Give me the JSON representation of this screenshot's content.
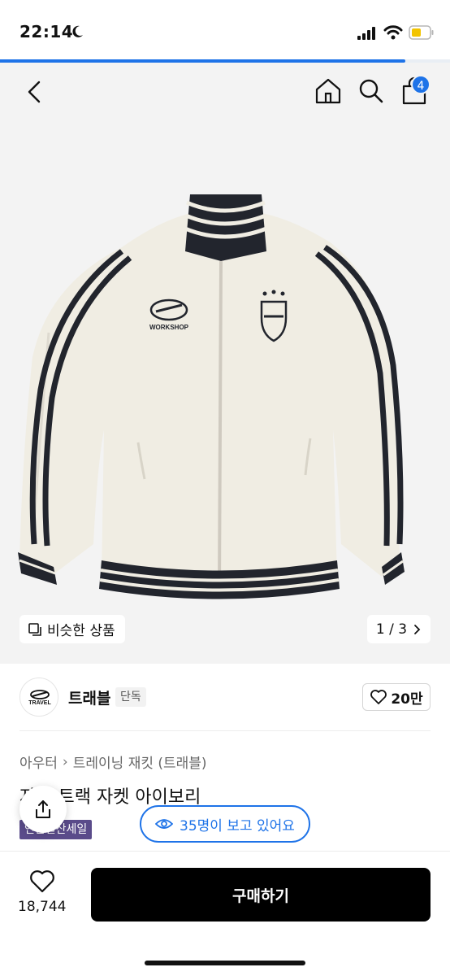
{
  "status_bar": {
    "time": "22:14"
  },
  "page_progress": 0.9,
  "header": {
    "cart_count": "4"
  },
  "product_image": {
    "similar_label": "비슷한 상품",
    "counter": "1 / 3",
    "jacket_print_text": "WORKSHOP"
  },
  "brand": {
    "name": "트래블",
    "tag": "단독",
    "logo_text": "TRAVEL",
    "likes": "20만"
  },
  "breadcrumb": {
    "category": "아우터",
    "subcategory": "트레이닝 재킷 (트래블)"
  },
  "product": {
    "title": "자켓 트랙 자켓 아이보리",
    "sale_tag": "연말결산세일"
  },
  "viewers": {
    "label": "35명이 보고 있어요"
  },
  "bottom_bar": {
    "wish_count": "18,744",
    "buy_label": "구매하기"
  },
  "colors": {
    "accent": "#1e73e8",
    "sale_tag": "#5a4b8a",
    "buy_button": "#000000"
  }
}
